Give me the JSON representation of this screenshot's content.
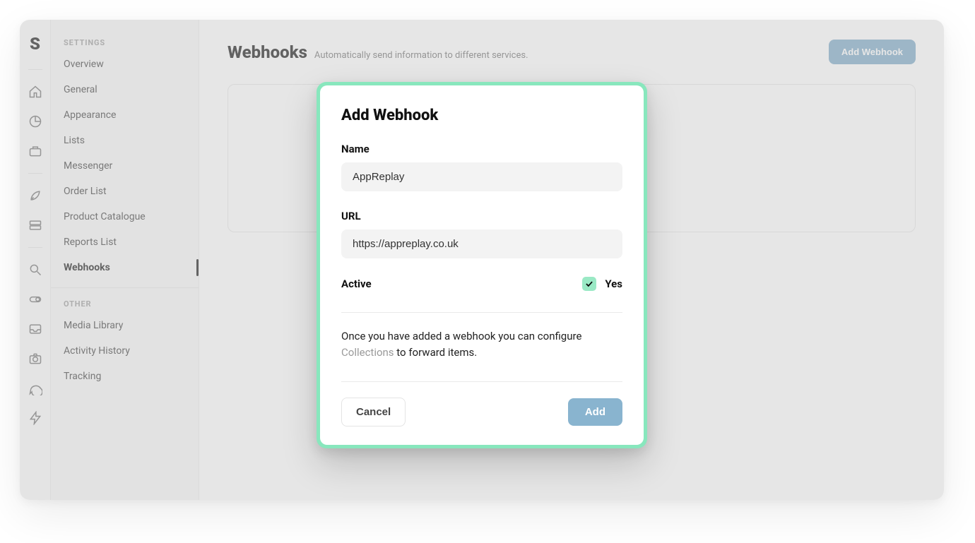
{
  "rail": {
    "logo": "S"
  },
  "sidebar": {
    "section_settings": "SETTINGS",
    "section_other": "OTHER",
    "settings_items": [
      {
        "label": "Overview"
      },
      {
        "label": "General"
      },
      {
        "label": "Appearance"
      },
      {
        "label": "Lists"
      },
      {
        "label": "Messenger"
      },
      {
        "label": "Order List"
      },
      {
        "label": "Product Catalogue"
      },
      {
        "label": "Reports List"
      },
      {
        "label": "Webhooks"
      }
    ],
    "other_items": [
      {
        "label": "Media Library"
      },
      {
        "label": "Activity History"
      },
      {
        "label": "Tracking"
      }
    ],
    "active_index": 8
  },
  "page": {
    "title": "Webhooks",
    "subtitle": "Automatically send information to different services.",
    "add_button": "Add Webhook"
  },
  "modal": {
    "title": "Add Webhook",
    "name_label": "Name",
    "name_value": "AppReplay",
    "url_label": "URL",
    "url_value": "https://appreplay.co.uk",
    "active_label": "Active",
    "active_value_text": "Yes",
    "active_checked": true,
    "help_pre": "Once you have added a webhook you can configure ",
    "help_link": "Collections",
    "help_post": " to forward items.",
    "cancel": "Cancel",
    "confirm": "Add"
  }
}
